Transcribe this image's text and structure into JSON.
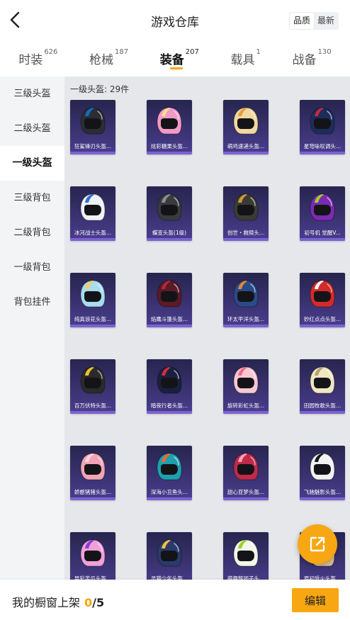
{
  "header": {
    "title": "游戏仓库",
    "sort": [
      {
        "label": "品质",
        "active": true
      },
      {
        "label": "最新",
        "active": false
      }
    ]
  },
  "tabs": [
    {
      "label": "时装",
      "count": "626",
      "active": false
    },
    {
      "label": "枪械",
      "count": "187",
      "active": false
    },
    {
      "label": "装备",
      "count": "207",
      "active": true
    },
    {
      "label": "载具",
      "count": "1",
      "active": false
    },
    {
      "label": "战备",
      "count": "130",
      "active": false
    }
  ],
  "sidebar": {
    "items": [
      {
        "label": "三级头盔",
        "active": false
      },
      {
        "label": "二级头盔",
        "active": false
      },
      {
        "label": "一级头盔",
        "active": true
      },
      {
        "label": "三级背包",
        "active": false
      },
      {
        "label": "二级背包",
        "active": false
      },
      {
        "label": "一级背包",
        "active": false
      },
      {
        "label": "背包挂件",
        "active": false
      }
    ]
  },
  "content": {
    "section_title": "一级头盔: 29件",
    "items": [
      {
        "name": "狂鲨锋刃头盔...",
        "color": "#2c2c34",
        "accent": "#0f6fb8"
      },
      {
        "name": "炫彩糖果头盔...",
        "color": "#f29ac7",
        "accent": "#f6e08a"
      },
      {
        "name": "萌鸡速递头盔...",
        "color": "#f0d8a0",
        "accent": "#e0a040"
      },
      {
        "name": "星穹咏叹调头...",
        "color": "#1d2d5a",
        "accent": "#c8283a"
      },
      {
        "name": "冰河战士头盔...",
        "color": "#eef2f8",
        "accent": "#2f6fd0"
      },
      {
        "name": "蝶变头盔(1级)",
        "color": "#3a3a3e",
        "accent": "#8a8a90"
      },
      {
        "name": "创世・救赎头...",
        "color": "#3b3b35",
        "accent": "#c89a3a"
      },
      {
        "name": "初号机 觉醒V...",
        "color": "#7b2bb2",
        "accent": "#9ad02a"
      },
      {
        "name": "纯真浪花头盔...",
        "color": "#a8dcef",
        "accent": "#f4d05a"
      },
      {
        "name": "焰鹰斗篷头盔...",
        "color": "#5a1a26",
        "accent": "#b02a3a"
      },
      {
        "name": "环太平洋头盔...",
        "color": "#2a4a8a",
        "accent": "#e08a30"
      },
      {
        "name": "妙红点点头盔...",
        "color": "#d42a2a",
        "accent": "#ffffff"
      },
      {
        "name": "百万伏特头盔...",
        "color": "#2b2b2b",
        "accent": "#f2c12e"
      },
      {
        "name": "暗夜行者头盔...",
        "color": "#1b2040",
        "accent": "#d0303a"
      },
      {
        "name": "旋转彩虹头盔...",
        "color": "#f8c8d2",
        "accent": "#f06a8a"
      },
      {
        "name": "田园牧歌头盔...",
        "color": "#efe6c2",
        "accent": "#b8a070"
      },
      {
        "name": "娇憨猪猪头盔...",
        "color": "#f2a4b4",
        "accent": "#fbd6de"
      },
      {
        "name": "深海小丑鱼头...",
        "color": "#1ea0b0",
        "accent": "#f06a2a"
      },
      {
        "name": "甜心亚梦头盔...",
        "color": "#c02a4a",
        "accent": "#f7a3b8"
      },
      {
        "name": "飞驰魅影头盔...",
        "color": "#f2f2f2",
        "accent": "#1a1a1a"
      },
      {
        "name": "异彩苦瓜头盔...",
        "color": "#f0a0d8",
        "accent": "#8c3ad0"
      },
      {
        "name": "灵猫少年头盔...",
        "color": "#2a3a6a",
        "accent": "#f0c040"
      },
      {
        "name": "萌趣熊团子头...",
        "color": "#f2f5e8",
        "accent": "#9ad02a"
      },
      {
        "name": "原初受火头盔...",
        "color": "#e0c090",
        "accent": "#c04020"
      }
    ]
  },
  "footer": {
    "showcase_label": "我的橱窗上架",
    "showcase_current": "0",
    "showcase_max": "/5",
    "edit_label": "编辑"
  },
  "colors": {
    "accent": "#f6a712",
    "card_bg": "#2f2c62",
    "sidebar_bg": "#f3f4f6",
    "content_bg": "#e6e7ea"
  }
}
